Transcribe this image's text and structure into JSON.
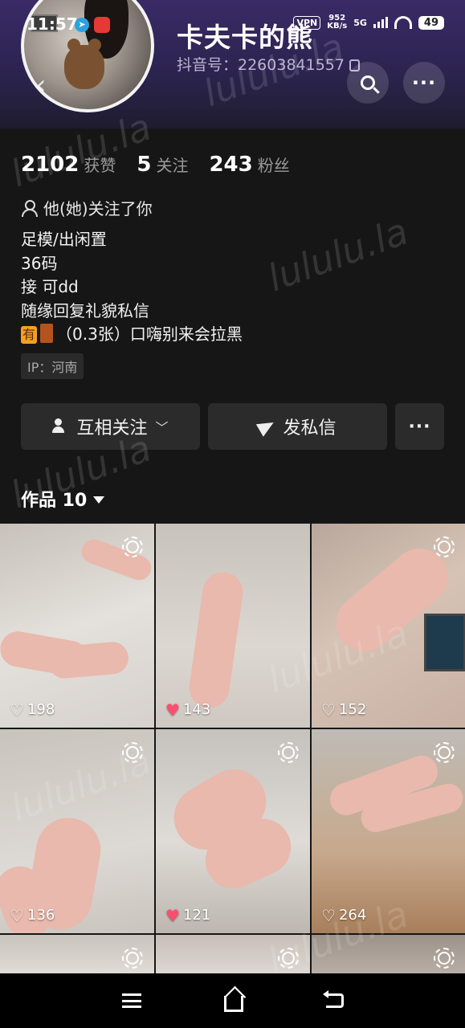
{
  "status_bar": {
    "time": "11:57",
    "vpn": "VPN",
    "net_speed_value": "952",
    "net_speed_unit": "KB/s",
    "network": "5G",
    "battery": "49"
  },
  "profile": {
    "nickname": "卡夫卡的熊",
    "douyin_id": "抖音号：22603841557",
    "stats": [
      {
        "number": "2102",
        "label": "获赞"
      },
      {
        "number": "5",
        "label": "关注"
      },
      {
        "number": "243",
        "label": "粉丝"
      }
    ],
    "follow_notice": "他(她)关注了你",
    "bio_lines": [
      "足模/出闲置",
      "36码",
      "接 可dd",
      "随缘回复礼貌私信"
    ],
    "bio_last_emoji": "有",
    "bio_last_text": "（0.3张）口嗨别来会拉黑",
    "ip": "IP：河南"
  },
  "actions": {
    "follow_label": "互相关注",
    "message_label": "发私信",
    "more_label": "···"
  },
  "works": {
    "label": "作品 10",
    "items": [
      {
        "likes": "198",
        "liked": false
      },
      {
        "likes": "143",
        "liked": true
      },
      {
        "likes": "152",
        "liked": false
      },
      {
        "likes": "136",
        "liked": false
      },
      {
        "likes": "121",
        "liked": true
      },
      {
        "likes": "264",
        "liked": false
      },
      {
        "likes": "",
        "liked": false
      },
      {
        "likes": "",
        "liked": false
      },
      {
        "likes": "",
        "liked": false
      }
    ]
  },
  "watermark": "lululu.la",
  "colors": {
    "header_bg": "#2c2450",
    "card_bg": "#161616",
    "button_bg": "#2b2b2b",
    "liked_heart": "#ff4d6d"
  }
}
